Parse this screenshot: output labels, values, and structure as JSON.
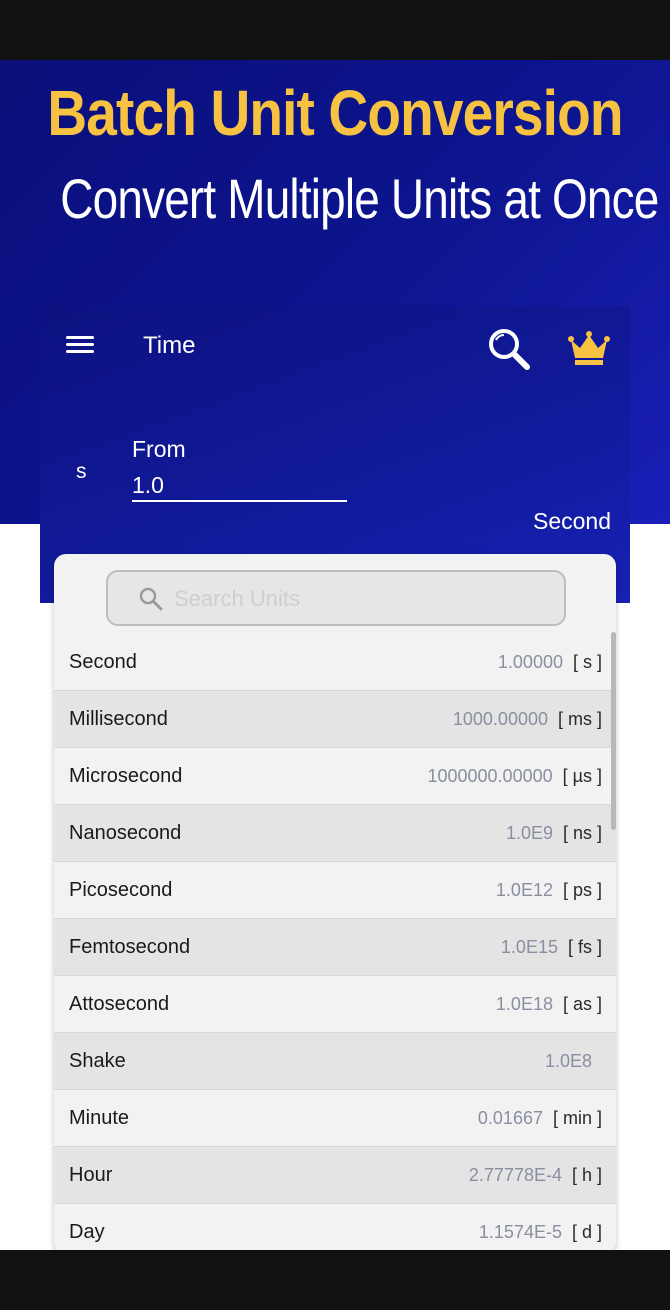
{
  "promo": {
    "headline": "Batch Unit Conversion",
    "subheadline": "Convert Multiple Units at Once"
  },
  "app": {
    "title": "Time",
    "menu_icon": "hamburger-menu-icon",
    "search_icon": "magnifier-icon",
    "premium_icon": "crown-icon",
    "colors": {
      "header": "#0c1280",
      "crown": "#f7c242",
      "headline": "#f7c242"
    }
  },
  "converter": {
    "unit_symbol": "s",
    "from_label": "From",
    "from_value": "1.0",
    "unit_name": "Second"
  },
  "search": {
    "placeholder": "Search Units"
  },
  "units": [
    {
      "name": "Second",
      "value": "1.00000",
      "symbol": "[ s ]"
    },
    {
      "name": "Millisecond",
      "value": "1000.00000",
      "symbol": "[ ms ]"
    },
    {
      "name": "Microsecond",
      "value": "1000000.00000",
      "symbol": "[ µs ]"
    },
    {
      "name": "Nanosecond",
      "value": "1.0E9",
      "symbol": "[ ns ]"
    },
    {
      "name": "Picosecond",
      "value": "1.0E12",
      "symbol": "[ ps ]"
    },
    {
      "name": "Femtosecond",
      "value": "1.0E15",
      "symbol": "[ fs ]"
    },
    {
      "name": "Attosecond",
      "value": "1.0E18",
      "symbol": "[ as ]"
    },
    {
      "name": "Shake",
      "value": "1.0E8",
      "symbol": ""
    },
    {
      "name": "Minute",
      "value": "0.01667",
      "symbol": "[ min ]"
    },
    {
      "name": "Hour",
      "value": "2.77778E-4",
      "symbol": "[ h ]"
    },
    {
      "name": "Day",
      "value": "1.1574E-5",
      "symbol": "[ d ]"
    }
  ]
}
